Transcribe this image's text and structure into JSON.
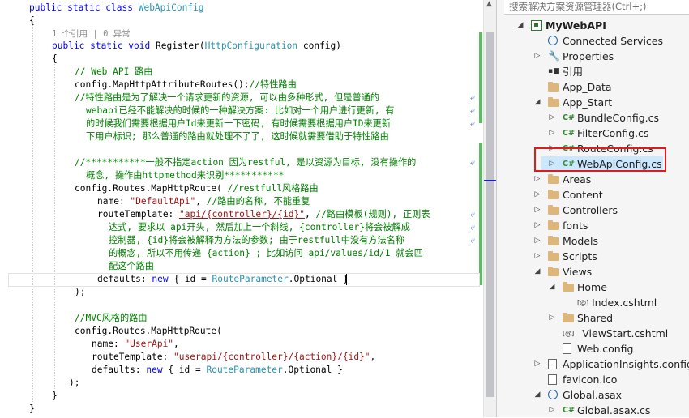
{
  "editor": {
    "lines": [
      [
        {
          "c": "kw",
          "t": "public static class "
        },
        {
          "c": "ty",
          "t": "WebApiConfig"
        }
      ],
      [
        {
          "c": "",
          "t": "{"
        }
      ],
      [
        {
          "c": "ref",
          "t": "1 个引用 | 0 异常"
        }
      ],
      [
        {
          "c": "kw",
          "t": "public static void "
        },
        {
          "c": "",
          "t": "Register("
        },
        {
          "c": "ty",
          "t": "HttpConfiguration"
        },
        {
          "c": "",
          "t": " config)"
        }
      ],
      [
        {
          "c": "",
          "t": "{"
        }
      ],
      [
        {
          "c": "cm",
          "t": "// Web API 路由"
        }
      ],
      [
        {
          "c": "",
          "t": "config.MapHttpAttributeRoutes();"
        },
        {
          "c": "cm",
          "t": "//特性路由"
        }
      ],
      [
        {
          "c": "cm",
          "t": "//特性路由是为了解决一个请求更新的资源, 可以由多种形式, 但是普通的"
        }
      ],
      [
        {
          "c": "cm",
          "t": "webapi已经不能解决的时候的一种解决方案: 比如对一个用户进行更新, 有"
        }
      ],
      [
        {
          "c": "cm",
          "t": "的时候我们需要根据用户Id来更新一下密码, 有时候需要根据用户ID来更新"
        }
      ],
      [
        {
          "c": "cm",
          "t": "下用户标识; 那么普通的路由就处理不了了, 这时候就需要借助于特性路由"
        }
      ],
      [
        {
          "c": "",
          "t": ""
        }
      ],
      [
        {
          "c": "cm",
          "t": "//***********一般不指定action 因为restful, 是以资源为目标, 没有操作的"
        }
      ],
      [
        {
          "c": "cm",
          "t": "概念, 操作由httpmethod来识别***********"
        }
      ],
      [
        {
          "c": "",
          "t": "config.Routes.MapHttpRoute( "
        },
        {
          "c": "cm",
          "t": "//restfull风格路由"
        }
      ],
      [
        {
          "c": "",
          "t": "name: "
        },
        {
          "c": "st",
          "t": "\"DefaultApi\""
        },
        {
          "c": "",
          "t": ", "
        },
        {
          "c": "cm",
          "t": "//路由的名称, 不能重复"
        }
      ],
      [
        {
          "c": "",
          "t": "routeTemplate: "
        },
        {
          "c": "lk",
          "t": "\"api/{controller}/{id}\""
        },
        {
          "c": "",
          "t": ", "
        },
        {
          "c": "cm",
          "t": "//路由模板(规则), 正则表"
        }
      ],
      [
        {
          "c": "cm",
          "t": "达式, 要求以 api开头, 然后加上一个斜线, {controller}将会被解成"
        }
      ],
      [
        {
          "c": "cm",
          "t": "控制器, {id}将会被解释为方法的参数; 由于restfull中没有方法名称"
        }
      ],
      [
        {
          "c": "cm",
          "t": "的概念, 所以不用传递 {action} ; 比如访问 api/values/id/1 就会匹"
        }
      ],
      [
        {
          "c": "cm",
          "t": "配这个路由"
        }
      ],
      [
        {
          "c": "",
          "t": "defaults: "
        },
        {
          "c": "kw",
          "t": "new"
        },
        {
          "c": "",
          "t": " { id = "
        },
        {
          "c": "ty",
          "t": "RouteParameter"
        },
        {
          "c": "",
          "t": ".Optional }"
        }
      ],
      [
        {
          "c": "",
          "t": ");"
        }
      ],
      [
        {
          "c": "",
          "t": ""
        }
      ],
      [
        {
          "c": "cm",
          "t": "//MVC风格的路由"
        }
      ],
      [
        {
          "c": "",
          "t": "config.Routes.MapHttpRoute("
        }
      ],
      [
        {
          "c": "",
          "t": "name: "
        },
        {
          "c": "st",
          "t": "\"UserApi\""
        },
        {
          "c": "",
          "t": ","
        }
      ],
      [
        {
          "c": "",
          "t": "routeTemplate: "
        },
        {
          "c": "st",
          "t": "\"userapi/{controller}/{action}/{id}\""
        },
        {
          "c": "",
          "t": ","
        }
      ],
      [
        {
          "c": "",
          "t": "defaults: "
        },
        {
          "c": "kw",
          "t": "new"
        },
        {
          "c": "",
          "t": " { id = "
        },
        {
          "c": "ty",
          "t": "RouteParameter"
        },
        {
          "c": "",
          "t": ".Optional }"
        }
      ],
      [
        {
          "c": "",
          "t": ");"
        }
      ],
      [
        {
          "c": "",
          "t": "}"
        }
      ],
      [
        {
          "c": "",
          "t": "}"
        }
      ]
    ]
  },
  "solution_explorer": {
    "search_placeholder": "搜索解决方案资源管理器(Ctrl+;)",
    "items": [
      {
        "label": "MyWebAPI",
        "icon": "project-icon",
        "expanded": true,
        "bold": true
      },
      {
        "label": "Connected Services",
        "icon": "connected-services-icon"
      },
      {
        "label": "Properties",
        "icon": "wrench-icon"
      },
      {
        "label": "引用",
        "icon": "references-icon"
      },
      {
        "label": "App_Data",
        "icon": "folder-icon"
      },
      {
        "label": "App_Start",
        "icon": "folder-icon",
        "expanded": true
      },
      {
        "label": "BundleConfig.cs",
        "icon": "csharp-file-icon"
      },
      {
        "label": "FilterConfig.cs",
        "icon": "csharp-file-icon"
      },
      {
        "label": "RouteConfig.cs",
        "icon": "csharp-file-icon"
      },
      {
        "label": "WebApiConfig.cs",
        "icon": "csharp-file-icon",
        "selected": true
      },
      {
        "label": "Areas",
        "icon": "folder-icon"
      },
      {
        "label": "Content",
        "icon": "folder-icon"
      },
      {
        "label": "Controllers",
        "icon": "folder-icon"
      },
      {
        "label": "fonts",
        "icon": "folder-icon"
      },
      {
        "label": "Models",
        "icon": "folder-icon"
      },
      {
        "label": "Scripts",
        "icon": "folder-icon"
      },
      {
        "label": "Views",
        "icon": "folder-icon",
        "expanded": true
      },
      {
        "label": "Home",
        "icon": "folder-icon",
        "expanded": true
      },
      {
        "label": "Index.cshtml",
        "icon": "cshtml-file-icon"
      },
      {
        "label": "Shared",
        "icon": "folder-icon"
      },
      {
        "label": "_ViewStart.cshtml",
        "icon": "cshtml-file-icon"
      },
      {
        "label": "Web.config",
        "icon": "config-file-icon"
      },
      {
        "label": "ApplicationInsights.config",
        "icon": "config-file-icon"
      },
      {
        "label": "favicon.ico",
        "icon": "ico-file-icon"
      },
      {
        "label": "Global.asax",
        "icon": "asax-file-icon"
      },
      {
        "label": "Global.asax.cs",
        "icon": "csharp-file-icon"
      }
    ]
  },
  "colors": {
    "keyword": "#0000ff",
    "type": "#2b91af",
    "comment": "#008000",
    "string": "#a31515",
    "highlight_box": "#e01b1b"
  }
}
